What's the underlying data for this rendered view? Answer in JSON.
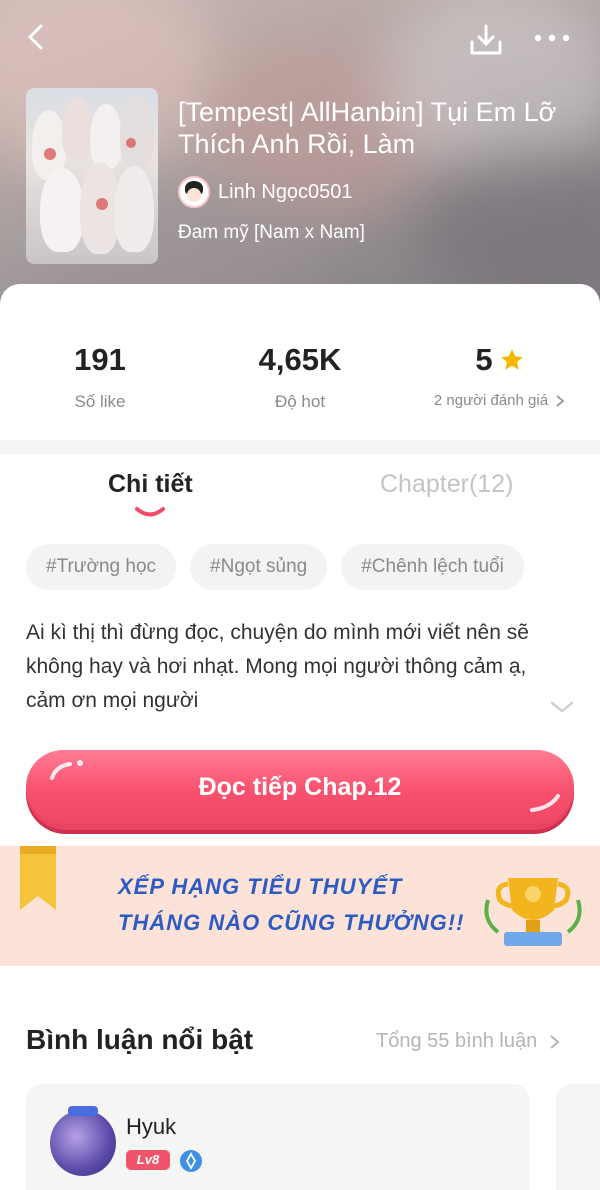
{
  "header": {
    "back_icon": "chevron-left-icon",
    "download_icon": "download-icon",
    "more_icon": "more-dots-icon"
  },
  "story": {
    "title": "[Tempest| AllHanbin] Tụi Em Lỡ Thích Anh Rồi, Làm",
    "author": "Linh Ngọc0501",
    "genre": "Đam mỹ [Nam x Nam]"
  },
  "stats": {
    "likes_value": "191",
    "likes_label": "Số like",
    "hot_value": "4,65K",
    "hot_label": "Độ hot",
    "rating_value": "5",
    "rating_label": "2 người đánh giá"
  },
  "tabs": [
    {
      "label": "Chi tiết",
      "active": true
    },
    {
      "label": "Chapter(12)",
      "active": false
    }
  ],
  "tags": [
    "#Trường học",
    "#Ngọt sủng",
    "#Chênh lệch tuổi"
  ],
  "description": "Ai kì thị thì đừng đọc, chuyện do mình mới viết nên sẽ không hay và hơi nhạt. Mong mọi người thông cảm ạ, cảm ơn mọi người",
  "read_button": "Đọc tiếp Chap.12",
  "banner": {
    "line1": "XẾP HẠNG TIỂU THUYẾT",
    "line2": "THÁNG NÀO CŨNG THƯỞNG!!"
  },
  "comments": {
    "heading": "Bình luận nổi bật",
    "total": "Tổng 55 bình luận",
    "items": [
      {
        "name": "Hyuk",
        "level": "Lv8"
      }
    ]
  },
  "colors": {
    "accent": "#f8516f",
    "star": "#f5b800",
    "banner_text": "#2d5bc4"
  }
}
